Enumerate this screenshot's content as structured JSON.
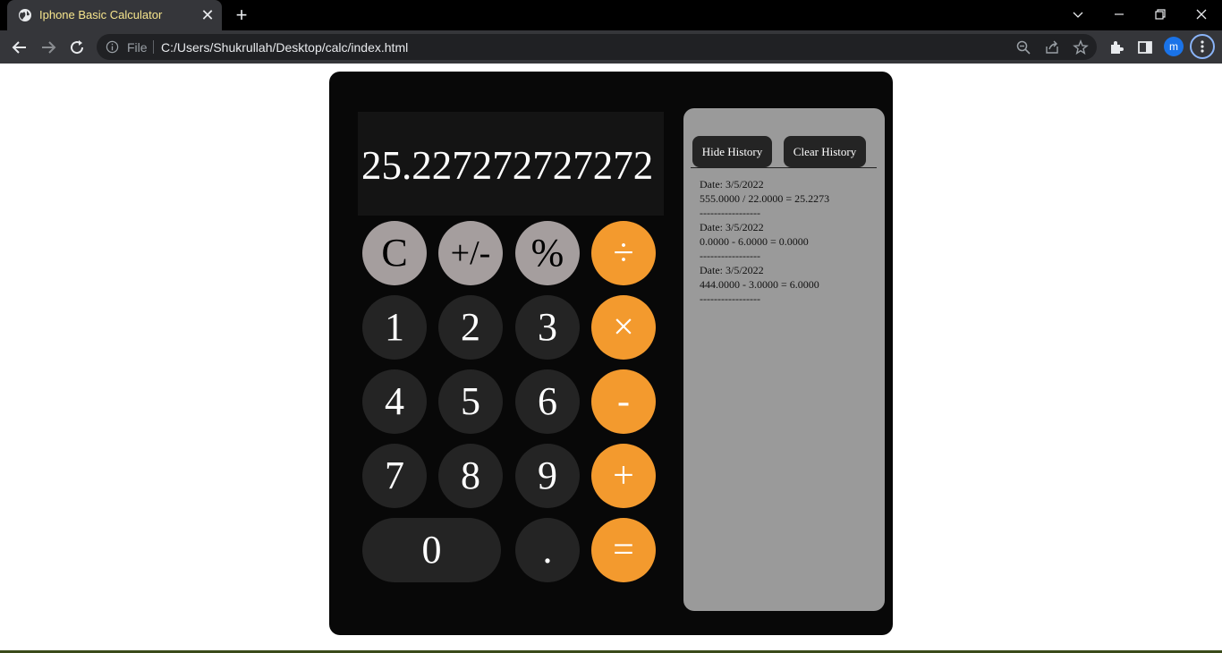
{
  "browser": {
    "tab_title": "Iphone Basic Calculator",
    "tab_close": "✕",
    "new_tab": "+",
    "file_label": "File",
    "url": "C:/Users/Shukrullah/Desktop/calc/index.html",
    "profile_initial": "m"
  },
  "calculator": {
    "display": "25.227272727272",
    "keys": {
      "clear": "C",
      "sign": "+/-",
      "percent": "%",
      "divide": "÷",
      "one": "1",
      "two": "2",
      "three": "3",
      "multiply": "×",
      "four": "4",
      "five": "5",
      "six": "6",
      "subtract": "-",
      "seven": "7",
      "eight": "8",
      "nine": "9",
      "add": "+",
      "zero": "0",
      "decimal": ".",
      "equals": "="
    }
  },
  "history": {
    "hide_label": "Hide History",
    "clear_label": "Clear History",
    "entries": [
      {
        "date": "Date: 3/5/2022",
        "expression": "555.0000 / 22.0000 = 25.2273",
        "separator": "-----------------"
      },
      {
        "date": "Date: 3/5/2022",
        "expression": "0.0000 - 6.0000 = 0.0000",
        "separator": "-----------------"
      },
      {
        "date": "Date: 3/5/2022",
        "expression": "444.0000 - 3.0000 = 6.0000",
        "separator": "-----------------"
      }
    ]
  },
  "colors": {
    "orange": "#f39a2e",
    "gray_key": "#a59e9e",
    "dark_key": "#242424",
    "history_bg": "#9a9a9a"
  }
}
